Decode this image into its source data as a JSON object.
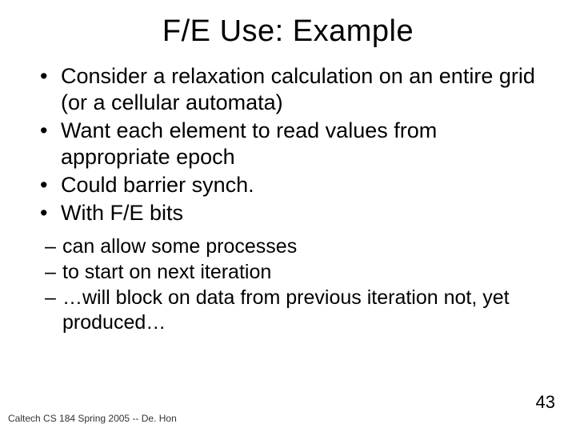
{
  "title": "F/E Use: Example",
  "bullets": [
    "Consider a relaxation calculation on an entire grid (or a cellular automata)",
    "Want each element to read values from appropriate epoch",
    "Could barrier synch.",
    "With F/E bits"
  ],
  "subbullets": [
    "can allow some processes",
    "to start on next iteration",
    "…will block on data from previous iteration not, yet produced…"
  ],
  "footer": "Caltech CS 184 Spring 2005 -- De. Hon",
  "page_number": "43"
}
